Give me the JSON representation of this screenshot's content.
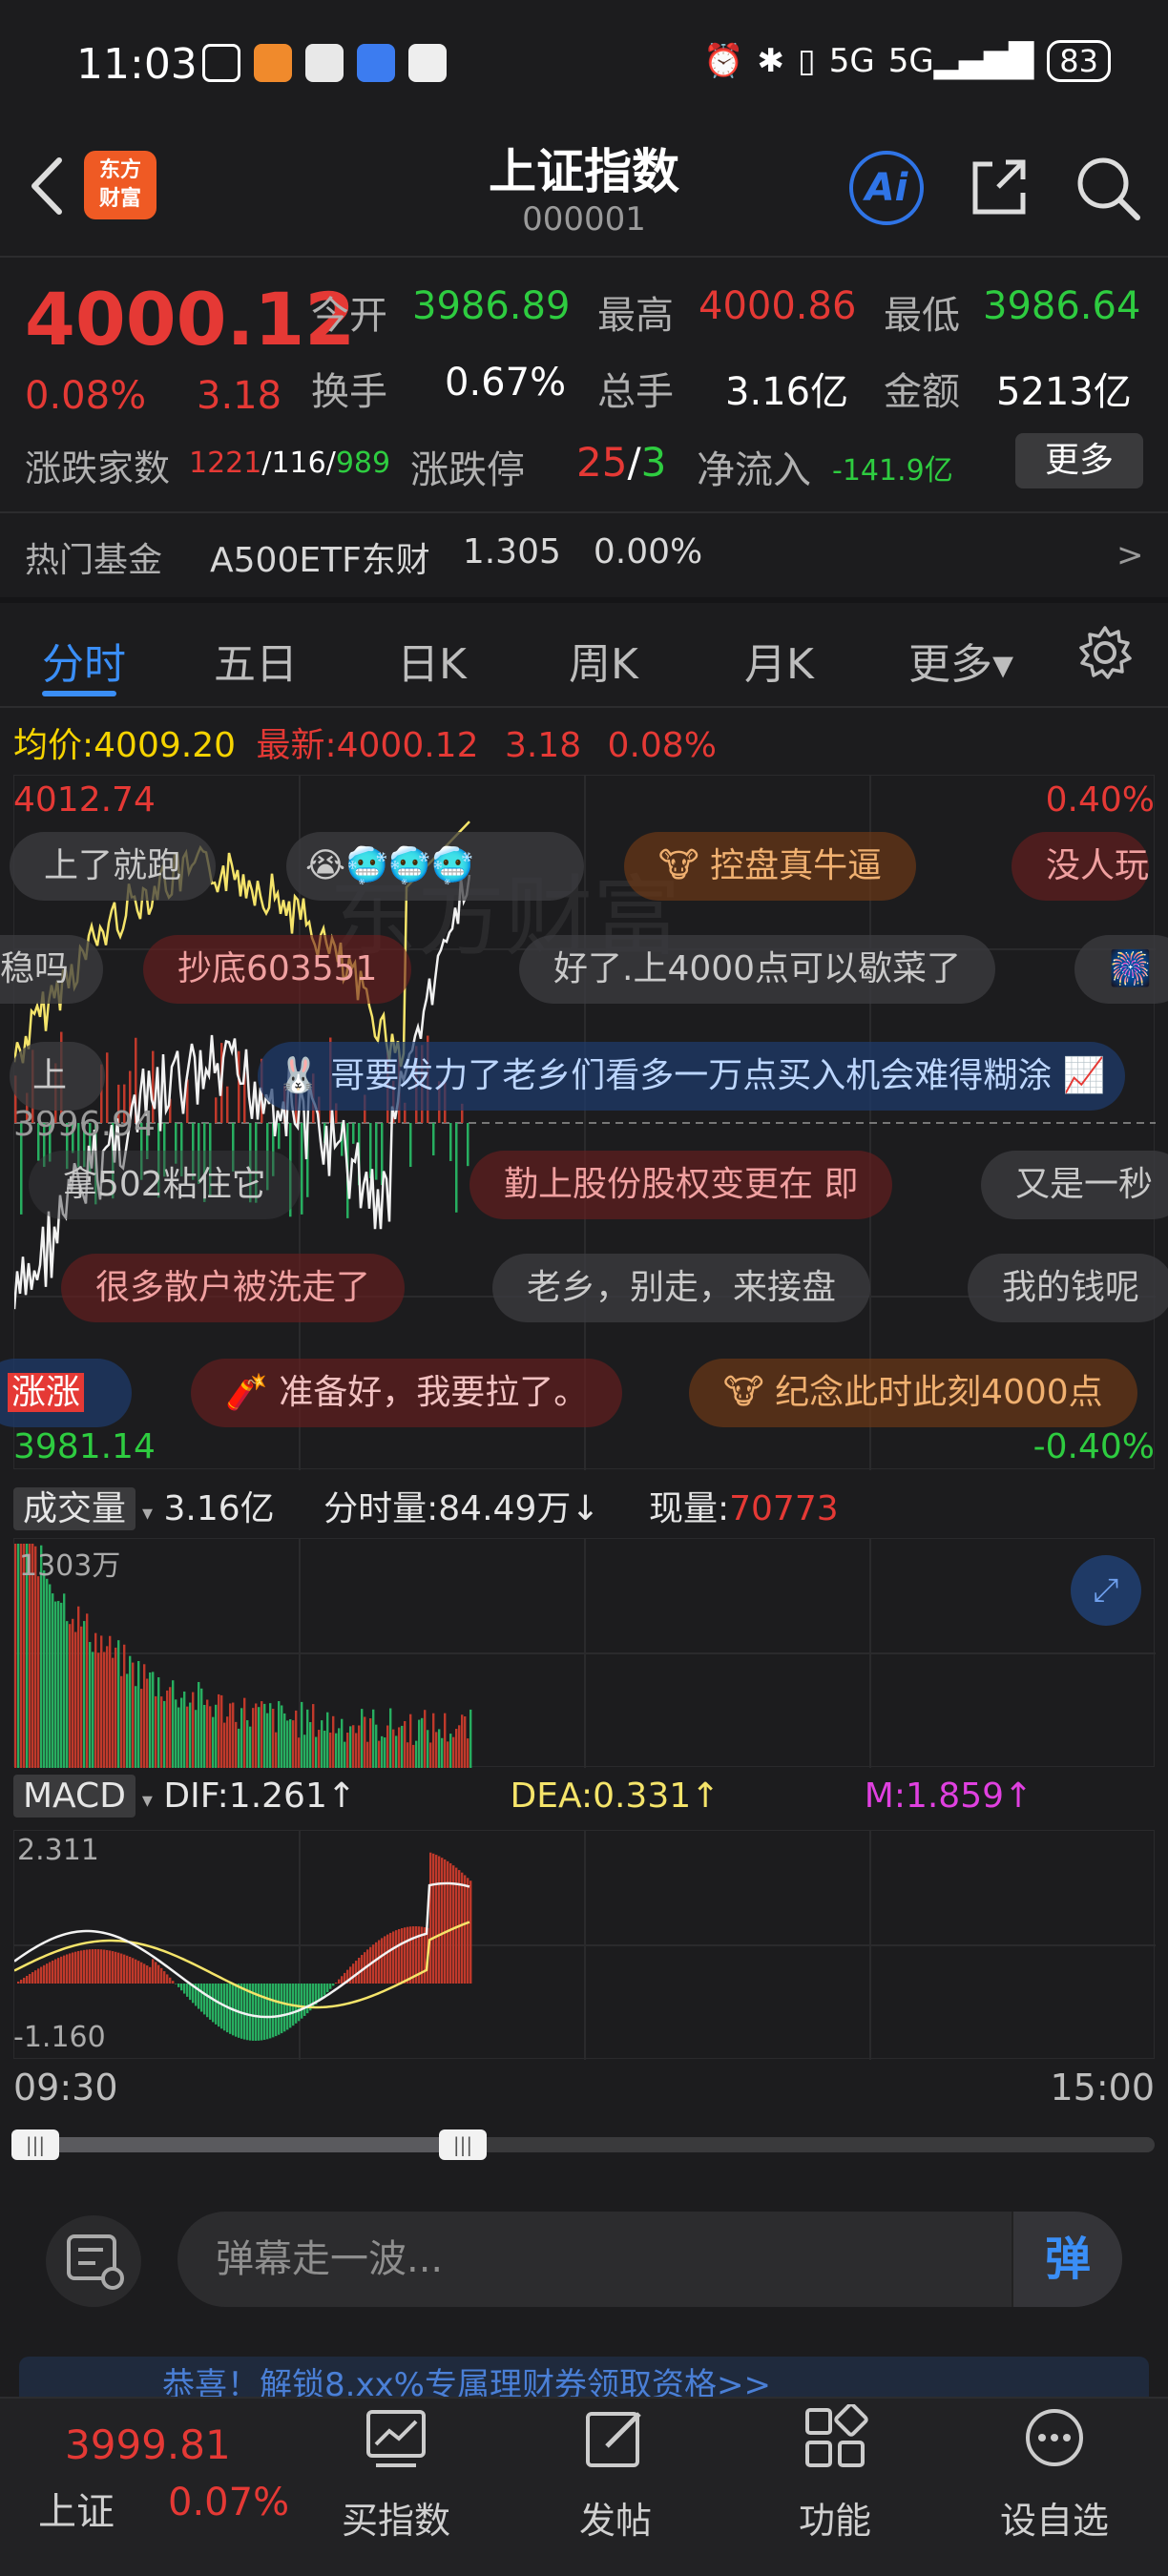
{
  "status_bar": {
    "time": "11:03",
    "battery": "83",
    "signal": "5G"
  },
  "header": {
    "title": "上证指数",
    "code": "000001",
    "logo_line1": "东方",
    "logo_line2": "财富",
    "ai_label": "Ai"
  },
  "quote": {
    "price": "4000.12",
    "pct": "0.08%",
    "change": "3.18",
    "open_label": "今开",
    "open": "3986.89",
    "high_label": "最高",
    "high": "4000.86",
    "low_label": "最低",
    "low": "3986.64",
    "turnover_label": "换手",
    "turnover": "0.67%",
    "volume_label": "总手",
    "volume": "3.16亿",
    "amount_label": "金额",
    "amount": "5213亿",
    "adv_label": "涨跌家数",
    "adv_up": "1221",
    "adv_flat": "116",
    "adv_down": "989",
    "limit_label": "涨跌停",
    "limit_up": "25",
    "limit_down": "3",
    "inflow_label": "净流入",
    "inflow": "-141.9亿",
    "more": "更多"
  },
  "hot_fund": {
    "label": "热门基金",
    "name": "A500ETF东财",
    "price": "1.305",
    "pct": "0.00%",
    "arrow": ">"
  },
  "tabs": [
    "分时",
    "五日",
    "日K",
    "周K",
    "月K",
    "更多▾"
  ],
  "avg_row": {
    "avg_label": "均价:",
    "avg": "4009.20",
    "latest_label": "最新:",
    "latest": "4000.12",
    "chg": "3.18",
    "pct": "0.08%"
  },
  "chart_axis": {
    "top_price": "4012.74",
    "top_pct": "0.40%",
    "mid_price": "3996.94",
    "bottom_price": "3981.14",
    "bottom_pct": "-0.40%"
  },
  "danmu": [
    "上了就跑",
    "控盘真牛逼",
    "没人玩",
    "稳吗",
    "抄底603551",
    "好了.上4000点可以歇菜了",
    "上",
    "哥要发力了老乡们看多一万点买入机会难得糊涂",
    "拿502粘住它",
    "勤上股份股权变更在 即",
    "又是一秒",
    "很多散户被洗走了",
    "老乡，别走，来接盘",
    "我的钱呢",
    "涨涨",
    "准备好，我要拉了。",
    "纪念此时此刻4000点"
  ],
  "volume": {
    "label": "成交量",
    "total": "3.16亿",
    "period_label": "分时量:",
    "period": "84.49万↓",
    "now_label": "现量:",
    "now": "70773",
    "max": "1303万"
  },
  "macd": {
    "label": "MACD",
    "dif": "DIF:1.261↑",
    "dea": "DEA:0.331↑",
    "m": "M:1.859↑",
    "max": "2.311",
    "min": "-1.160"
  },
  "time_axis": {
    "start": "09:30",
    "end": "15:00"
  },
  "input": {
    "placeholder": "弹幕走一波...",
    "send": "弹"
  },
  "banner": {
    "text": "恭喜！解锁8.xx%专属理财券领取资格>>"
  },
  "tabbar": {
    "price": "3999.81",
    "name": "上证",
    "pct": "0.07%",
    "items": [
      "买指数",
      "发帖",
      "功能",
      "设自选"
    ]
  },
  "colors": {
    "up": "#e53935",
    "down": "#2ecc40",
    "accent": "#3a8ef6",
    "bg": "#1c1c1e"
  }
}
